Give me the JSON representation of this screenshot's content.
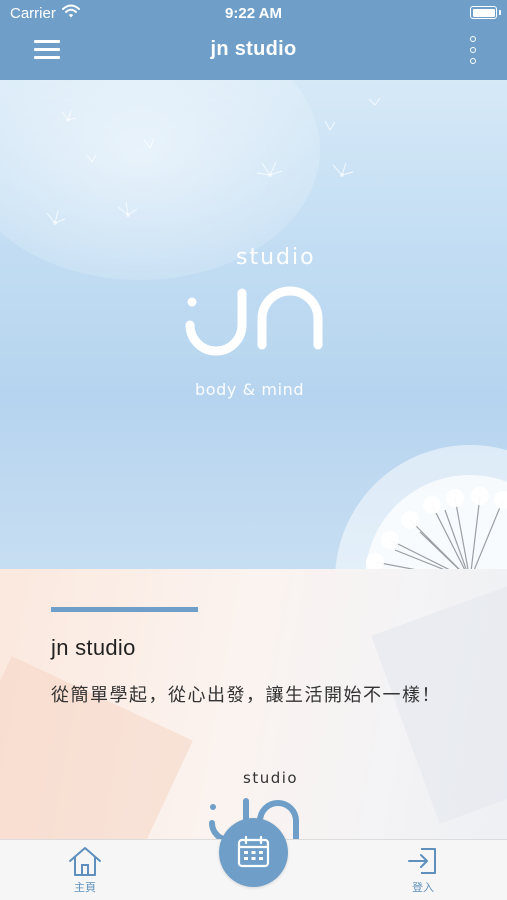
{
  "status_bar": {
    "carrier": "Carrier",
    "time": "9:22 AM",
    "icons": [
      "wifi-icon",
      "battery-icon"
    ]
  },
  "nav": {
    "title": "jn studio",
    "icons": [
      "menu-icon",
      "more-icon"
    ]
  },
  "hero": {
    "logo_studio": "studio",
    "logo_tagline": "body & mind"
  },
  "content": {
    "studio_name": "jn studio",
    "slogan": "從簡單學起，從心出發，讓生活開始不一樣！",
    "logo_studio": "studio"
  },
  "tab_bar": {
    "home_label": "主頁",
    "login_label": "登入",
    "icons": [
      "home-icon",
      "calendar-icon",
      "login-icon"
    ]
  },
  "colors": {
    "header": "#6f9fc8",
    "accent": "#6f9fc8",
    "tab_label": "#5e8fbd"
  }
}
